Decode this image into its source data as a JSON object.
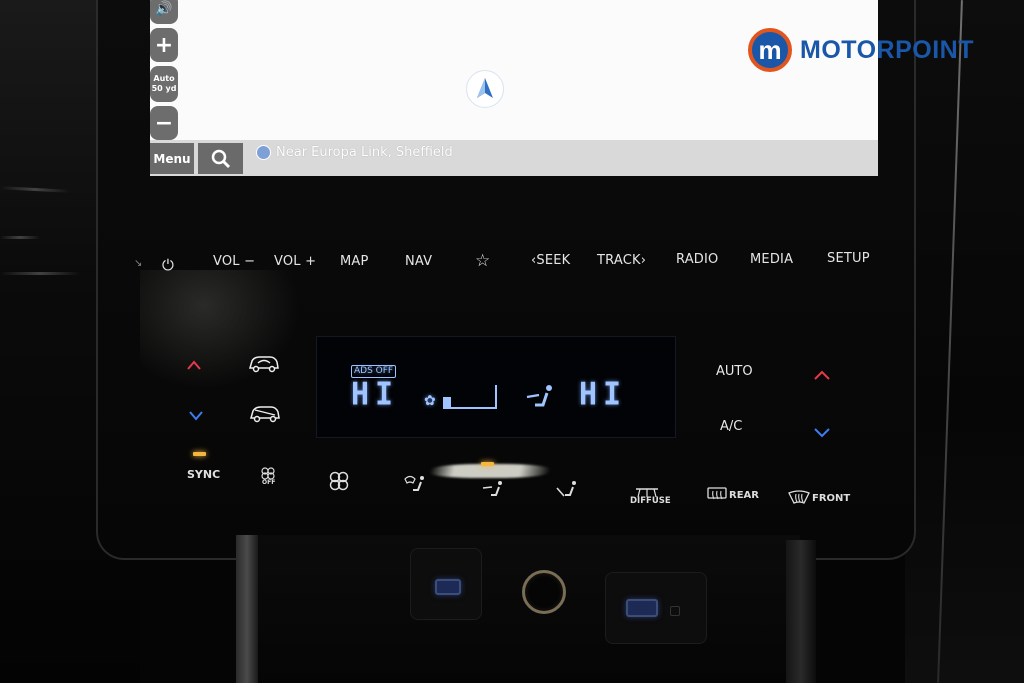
{
  "branding": {
    "logo_letter": "m",
    "logo_text": "MOTORPOINT",
    "colors": {
      "blue": "#1a57a8",
      "orange": "#e0561e"
    }
  },
  "navigation_screen": {
    "zoom_in_label": "+",
    "zoom_auto_label_line1": "Auto",
    "zoom_auto_label_line2": "50 yd",
    "zoom_out_label": "−",
    "menu_label": "Menu",
    "search_icon": "search-icon",
    "location_text": "Near Europa Link, Sheffield",
    "compass_icon": "compass-arrow-icon"
  },
  "head_unit_buttons": [
    {
      "id": "power",
      "label": "⏻"
    },
    {
      "id": "vol-down",
      "label": "VOL −"
    },
    {
      "id": "vol-up",
      "label": "VOL +"
    },
    {
      "id": "map",
      "label": "MAP"
    },
    {
      "id": "nav",
      "label": "NAV"
    },
    {
      "id": "favorite",
      "label": "☆"
    },
    {
      "id": "seek",
      "label": "‹SEEK"
    },
    {
      "id": "track",
      "label": "TRACK›"
    },
    {
      "id": "radio",
      "label": "RADIO"
    },
    {
      "id": "media",
      "label": "MEDIA"
    },
    {
      "id": "setup",
      "label": "SETUP"
    }
  ],
  "climate_display": {
    "ads_status": "ADS OFF",
    "driver_temp": "HI",
    "passenger_temp": "HI",
    "fan_level_fraction": 0.15,
    "lcd_color": "#9fc4ff"
  },
  "climate_controls": {
    "auto_label": "AUTO",
    "ac_label": "A/C",
    "sync_label": "SYNC",
    "sync_indicator_on": true,
    "fan_off_label": "OFF",
    "diffuse_label": "DIFFUSE",
    "rear_label": "REAR",
    "front_label": "FRONT",
    "temp_up_color": "#e8394a",
    "temp_down_color": "#3c7df0",
    "indicator_color": "#f5b640"
  }
}
